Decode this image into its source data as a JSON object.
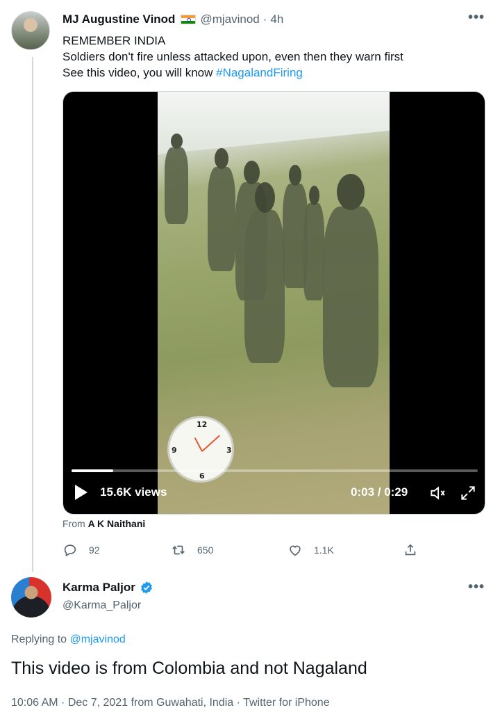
{
  "tweet": {
    "display_name": "MJ Augustine Vinod",
    "handle": "@mjavinod",
    "separator": "·",
    "age": "4h",
    "line1": "REMEMBER INDIA",
    "line2": "Soldiers don't fire unless attacked upon, even then they warn first",
    "line3_prefix": "See this video, you will know ",
    "hashtag": "#NagalandFiring",
    "more": "•••",
    "flag_icon": "india-flag-icon"
  },
  "video": {
    "views": "15.6K views",
    "time": "0:03 / 0:29",
    "progress": 0.103,
    "clock": {
      "n12": "12",
      "n3": "3",
      "n6": "6",
      "n9": "9"
    },
    "from_label": "From ",
    "from_name": "A K Naithani"
  },
  "actions": {
    "replies": "92",
    "retweets": "650",
    "likes": "1.1K"
  },
  "reply": {
    "display_name": "Karma Paljor",
    "handle": "@Karma_Paljor",
    "replying_prefix": "Replying to ",
    "replying_to": "@mjavinod",
    "text": "This video is from Colombia and not Nagaland",
    "timestamp": "10:06 AM · Dec 7, 2021 from Guwahati, India · Twitter for iPhone",
    "more": "•••"
  },
  "colors": {
    "link": "#1d9bf0",
    "muted": "#536471",
    "text": "#0f1419",
    "verified": "#1d9bf0"
  }
}
